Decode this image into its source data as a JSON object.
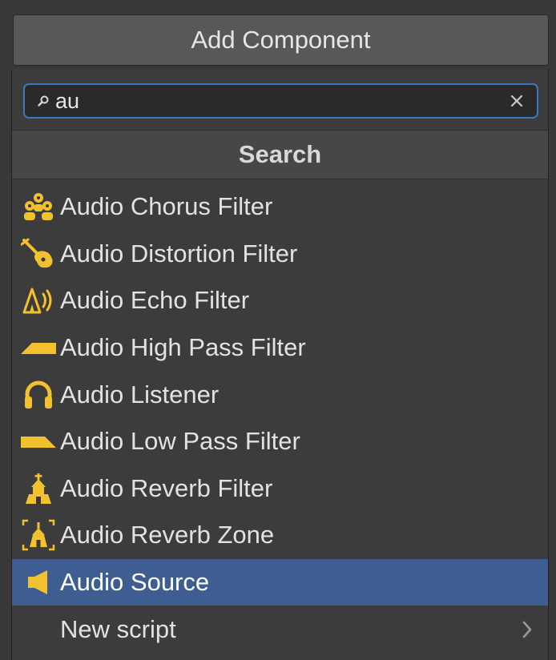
{
  "add_component": {
    "label": "Add Component"
  },
  "search": {
    "value": "au",
    "placeholder": ""
  },
  "section_header": "Search",
  "items": [
    {
      "label": "Audio Chorus Filter",
      "icon": "audio-chorus-filter-icon"
    },
    {
      "label": "Audio Distortion Filter",
      "icon": "audio-distortion-filter-icon"
    },
    {
      "label": "Audio Echo Filter",
      "icon": "audio-echo-filter-icon"
    },
    {
      "label": "Audio High Pass Filter",
      "icon": "audio-high-pass-filter-icon"
    },
    {
      "label": "Audio Listener",
      "icon": "audio-listener-icon"
    },
    {
      "label": "Audio Low Pass Filter",
      "icon": "audio-low-pass-filter-icon"
    },
    {
      "label": "Audio Reverb Filter",
      "icon": "audio-reverb-filter-icon"
    },
    {
      "label": "Audio Reverb Zone",
      "icon": "audio-reverb-zone-icon"
    },
    {
      "label": "Audio Source",
      "icon": "audio-source-icon",
      "selected": true
    },
    {
      "label": "New script",
      "icon": "chevron-right-icon"
    }
  ],
  "colors": {
    "background": "#383838",
    "selected": "#3e5e92",
    "focus_border": "#3a79bb",
    "icon_accent": "#f2c12e"
  }
}
